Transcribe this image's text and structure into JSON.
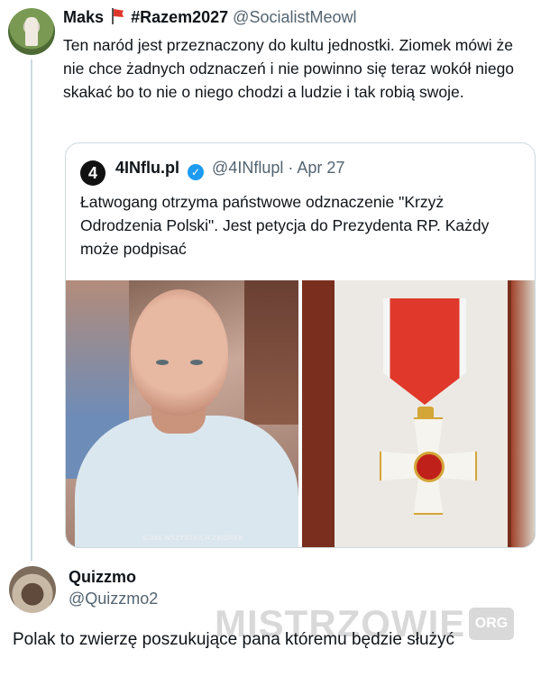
{
  "tweet": {
    "display_name": "Maks",
    "display_name_tag": "#Razem2027",
    "handle": "@SocialistMeowl",
    "text": "Ten naród jest przeznaczony do kultu jednostki. Ziomek mówi że nie chce żadnych odznaczeń i nie powinno się teraz wokół niego skakać bo to nie o niego chodzi a ludzie i tak robią swoje.",
    "avatar_icon": "cat-avatar",
    "flag_icon": "red-flag-icon"
  },
  "quoted_tweet": {
    "logo_text": "4",
    "display_name": "4INflu.pl",
    "handle": "@4INflupl",
    "separator": "·",
    "date": "Apr 27",
    "verified_icon": "verified-badge-icon",
    "text": "Łatwogang otrzyma państwowe odznaczenie \"Krzyż Odrodzenia Polski\". Jest petycja do Prezydenta RP. Każdy może podpisać",
    "media": {
      "left_image_caption": "SUMA WSZYSTKICH ZBIÓREK"
    }
  },
  "reply": {
    "display_name": "Quizzmo",
    "handle": "@Quizzmo2",
    "text": "Polak to zwierzę poszukujące pana któremu będzie służyć"
  },
  "watermark": {
    "text": "MISTRZOWIE",
    "suffix": "ORG"
  }
}
